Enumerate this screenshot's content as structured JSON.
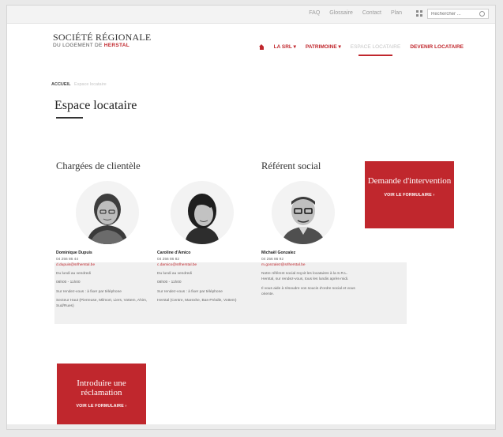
{
  "topbar": {
    "links": [
      "FAQ",
      "Glossaire",
      "Contact",
      "Plan"
    ],
    "search_placeholder": "Rechercher ..."
  },
  "logo": {
    "line1": "SOCIÉTÉ RÉGIONALE",
    "line2_prefix": "DU LOGEMENT DE ",
    "line2_highlight": "HERSTAL"
  },
  "nav": {
    "items": [
      "LA SRL ▾",
      "PATRIMOINE ▾",
      "ESPACE LOCATAIRE",
      "DEVENIR LOCATAIRE"
    ]
  },
  "breadcrumb": {
    "home": "ACCUEIL",
    "current": "Espace locataire"
  },
  "page_title": "Espace locataire",
  "sections": {
    "clientele": "Chargées de clientèle",
    "social": "Référent social"
  },
  "people": [
    {
      "name": "Dominique Dupuis",
      "phone": "04 256 86 44",
      "email": "d.dupuis@srlherstal.be",
      "p1": "Du lundi au vendredi",
      "p2": "08h00 - 11h00",
      "p3": "Sur rendez-vous : à fixer par téléphone",
      "p4": "Secteur Haut (Pierreuse, Milmort, Liers, Vottem, Ahim, Sud/Rues)"
    },
    {
      "name": "Caroline d'Amico",
      "phone": "04 256 86 82",
      "email": "c.damico@srlherstal.be",
      "p1": "Du lundi au vendredi",
      "p2": "08h00 - 11h00",
      "p3": "Sur rendez-vous : à fixer par téléphone",
      "p4": "Herstal (Centre, Marexhe, Bas-Préalle, Vottem)"
    },
    {
      "name": "Michaël Gonzalez",
      "phone": "04 256 86 92",
      "email": "m.gonzalez@srlherstal.be",
      "p1": "Notre référent social reçoit les locataires à la S.R.L. Herstal, sur rendez-vous, tous les lundis après-midi.",
      "p2": "Il vous aide à résoudre vos soucis d'ordre social et vous oriente.",
      "p3": "",
      "p4": ""
    }
  ],
  "boxes": {
    "intervention_title": "Demande d'intervention",
    "intervention_button": "VOIR LE FORMULAIRE ›",
    "reclamation_title": "Introduire une réclamation",
    "reclamation_button": "VOIR LE FORMULAIRE ›"
  },
  "colors": {
    "accent": "#c0272d",
    "text": "#333333",
    "muted": "#9a9a9a"
  }
}
